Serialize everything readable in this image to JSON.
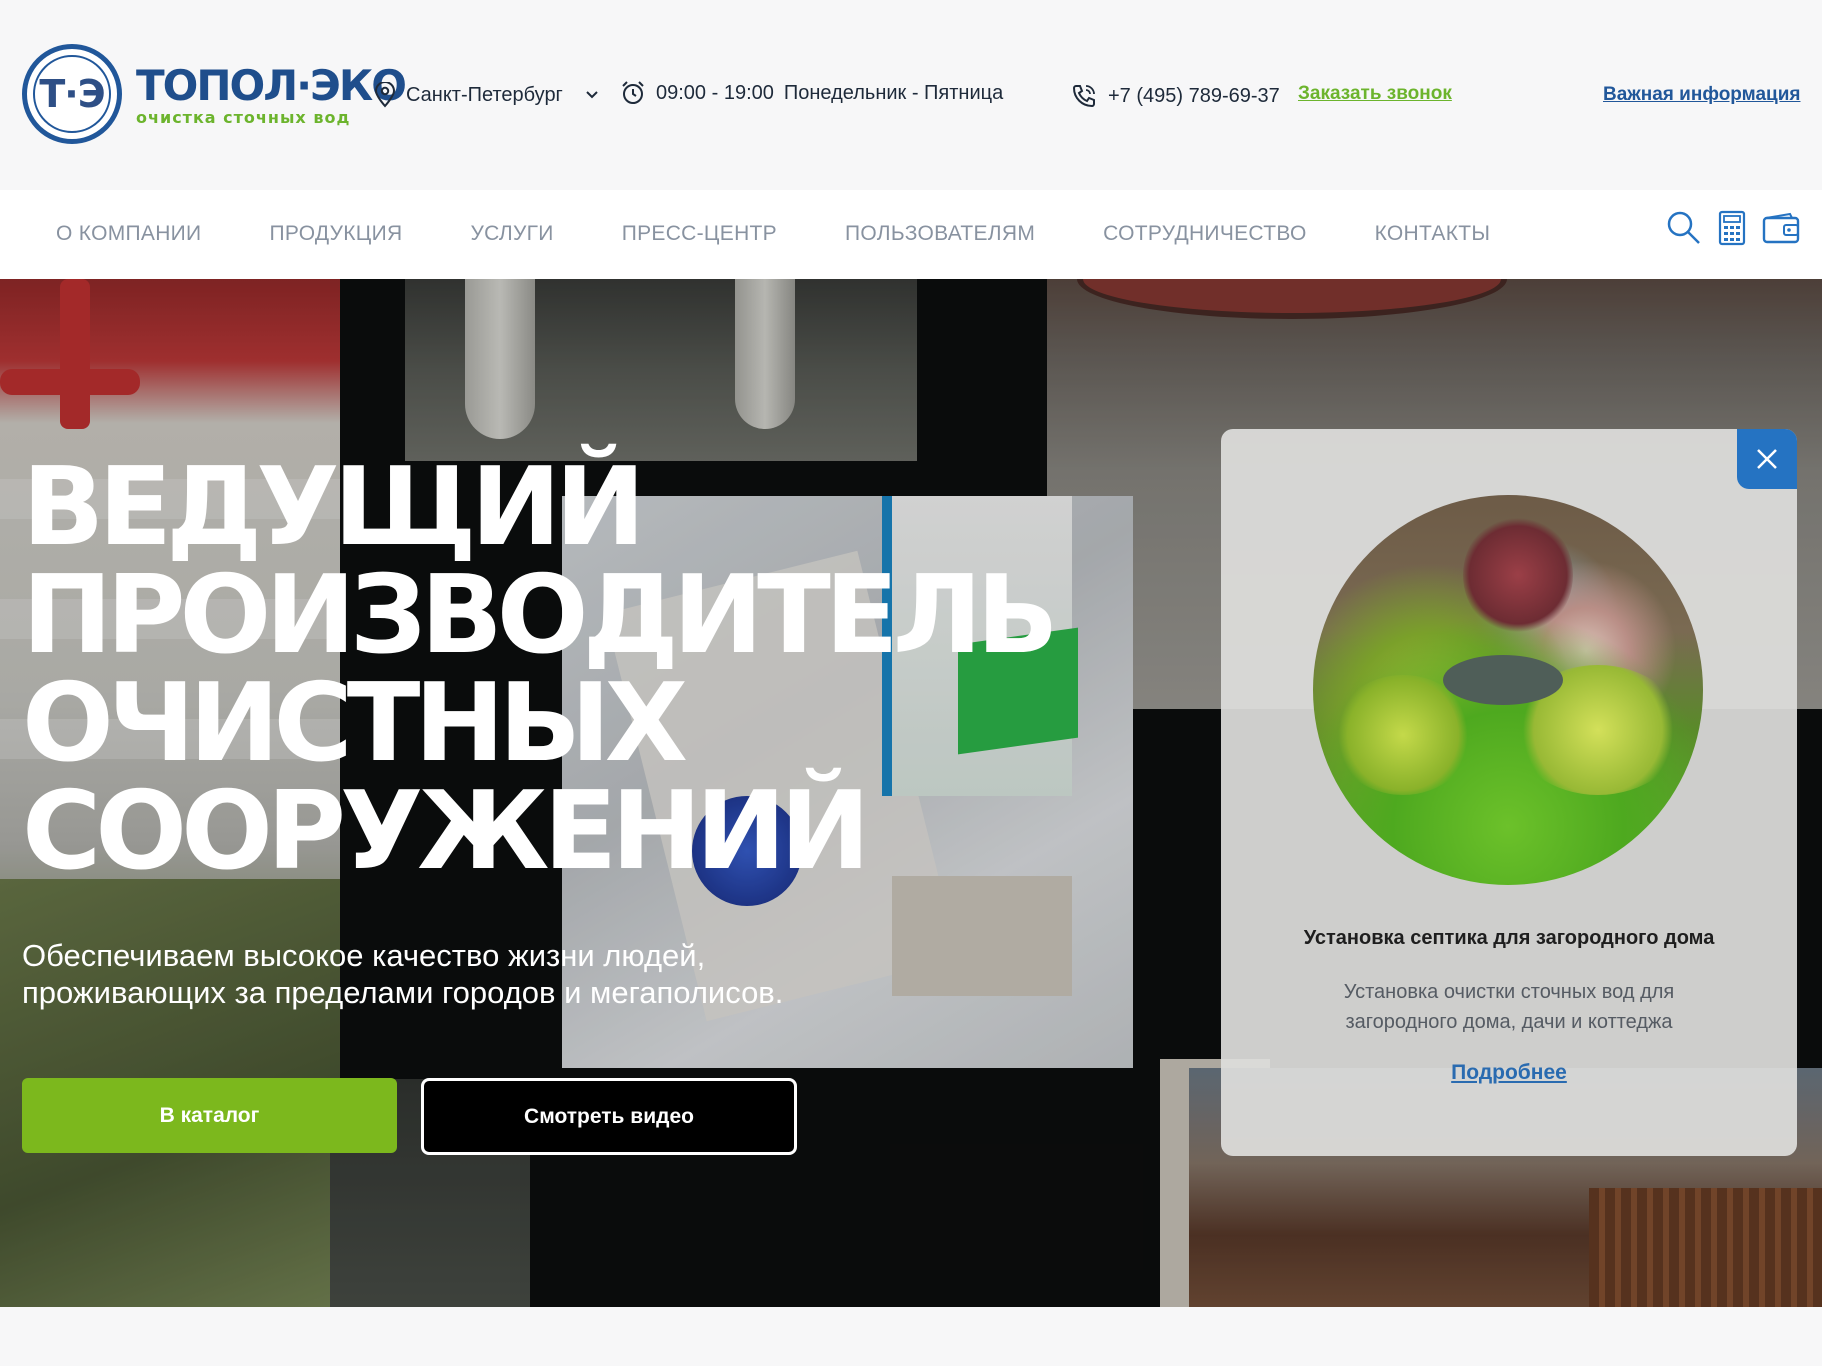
{
  "header": {
    "logo_mark": "Т·Э",
    "logo_title": "ТОПОЛ·ЭКО",
    "logo_subtitle": "очистка сточных вод",
    "city": "Санкт-Петербург",
    "hours": "09:00 - 19:00",
    "days": "Понедельник - Пятница",
    "phone": "+7 (495) 789-69-37",
    "callback": "Заказать звонок",
    "important": "Важная информация"
  },
  "nav": {
    "items": [
      "О компании",
      "Продукция",
      "Услуги",
      "Пресс-центр",
      "Пользователям",
      "Сотрудничество",
      "Контакты"
    ],
    "icons": [
      "search-icon",
      "calculator-icon",
      "wallet-icon"
    ]
  },
  "hero": {
    "title_lines": [
      "ВЕДУЩИЙ",
      "ПРОИЗВОДИТЕЛЬ",
      "ОЧИСТНЫХ",
      "СООРУЖЕНИЙ"
    ],
    "subtitle": "Обеспечиваем высокое качество жизни людей, проживающих за пределами городов и мегаполисов.",
    "catalog_button": "В каталог",
    "video_button": "Смотреть видео"
  },
  "popup": {
    "title": "Установка септика для загородного дома",
    "text": "Установка очистки сточных вод для загородного дома, дачи и коттеджа",
    "link": "Подробнее",
    "close_icon": "close-icon"
  },
  "colors": {
    "brand_blue": "#21579a",
    "brand_green": "#6cb42d",
    "catalog_green": "#7cb81d",
    "close_blue": "#2573c2"
  }
}
